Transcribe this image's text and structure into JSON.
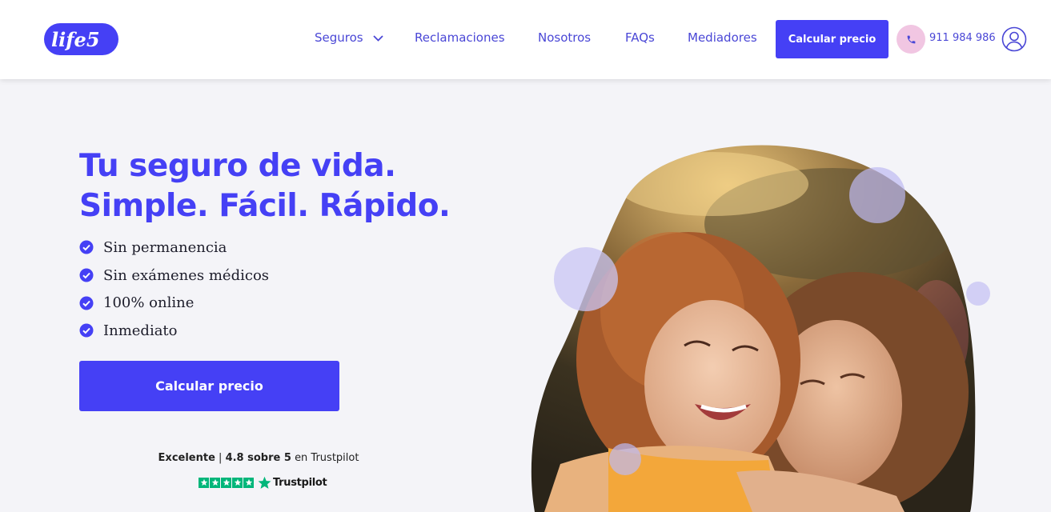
{
  "header": {
    "logo_text": "life5",
    "nav": [
      {
        "label": "Seguros",
        "has_dropdown": true
      },
      {
        "label": "Reclamaciones"
      },
      {
        "label": "Nosotros"
      },
      {
        "label": "FAQs"
      },
      {
        "label": "Mediadores"
      }
    ],
    "cta_label": "Calcular precio",
    "phone": "911 984 986",
    "phone_icon": "phone-icon",
    "user_icon": "user-icon"
  },
  "hero": {
    "title_line1": "Tu seguro de vida.",
    "title_line2": "Simple. Fácil. Rápido.",
    "features": [
      "Sin permanencia",
      "Sin exámenes médicos",
      "100% online",
      "Inmediato"
    ],
    "cta_label": "Calcular precio",
    "rating": {
      "word": "Excelente",
      "separator": "|",
      "score_text": "4.8 sobre 5",
      "suffix": "en Trustpilot"
    },
    "trustpilot_label": "Trustpilot"
  },
  "colors": {
    "brand": "#4540f5",
    "nav_text": "#4a47d6",
    "phone_bg": "#f1c6e2",
    "background": "#f4f4f8",
    "trustpilot_green": "#00b67a",
    "bubble": "#c9c6f4"
  }
}
